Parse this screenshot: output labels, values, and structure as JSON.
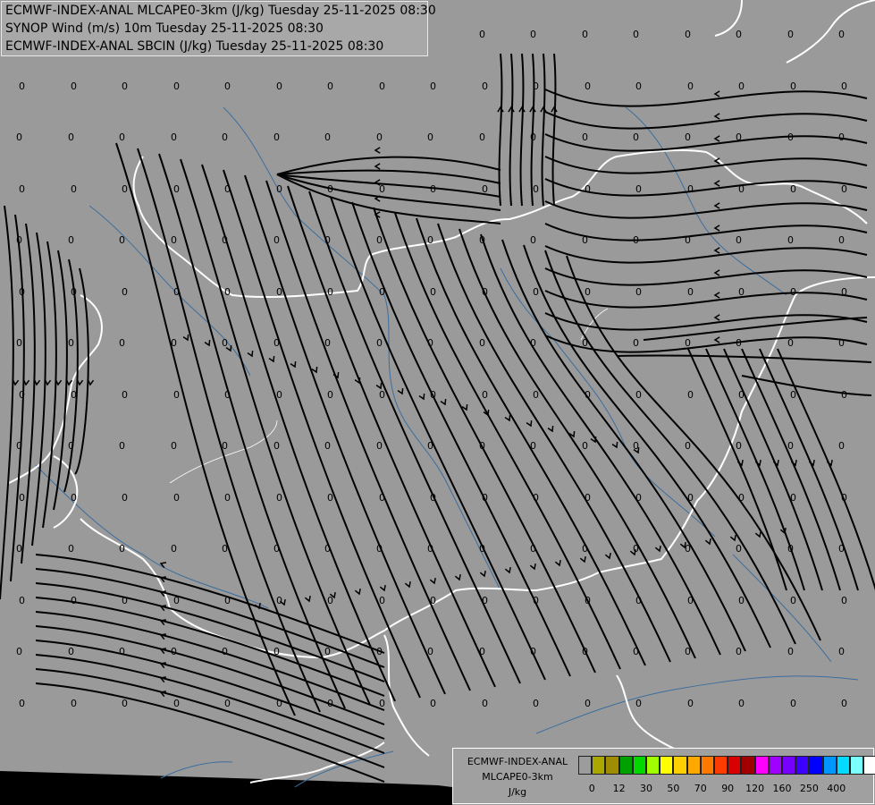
{
  "header": {
    "line1": "ECMWF-INDEX-ANAL MLCAPE0-3km (J/kg) Tuesday 25-11-2025 08:30",
    "line2": "SYNOP Wind (m/s) 10m Tuesday 25-11-2025 08:30",
    "line3": "ECMWF-INDEX-ANAL SBCIN (J/kg) Tuesday 25-11-2025 08:30"
  },
  "legend": {
    "title_line1": "ECMWF-INDEX-ANAL",
    "title_line2": "MLCAPE0-3km",
    "title_line3": "J/kg",
    "colors": [
      "#9c9c9c",
      "#a8a800",
      "#a08c00",
      "#00a000",
      "#00d800",
      "#a0ff00",
      "#ffff00",
      "#ffd000",
      "#ffa800",
      "#ff7800",
      "#ff3c00",
      "#d80000",
      "#a00000",
      "#ff00ff",
      "#a000ff",
      "#7800ff",
      "#3c00ff",
      "#0000ff",
      "#0096ff",
      "#00dcff",
      "#7cffff",
      "#ffffff"
    ],
    "ticks": [
      "0",
      "12",
      "30",
      "50",
      "70",
      "90",
      "120",
      "160",
      "250",
      "400"
    ]
  },
  "map": {
    "background_color": "#9a9a9a",
    "grid_value_label": "0"
  }
}
